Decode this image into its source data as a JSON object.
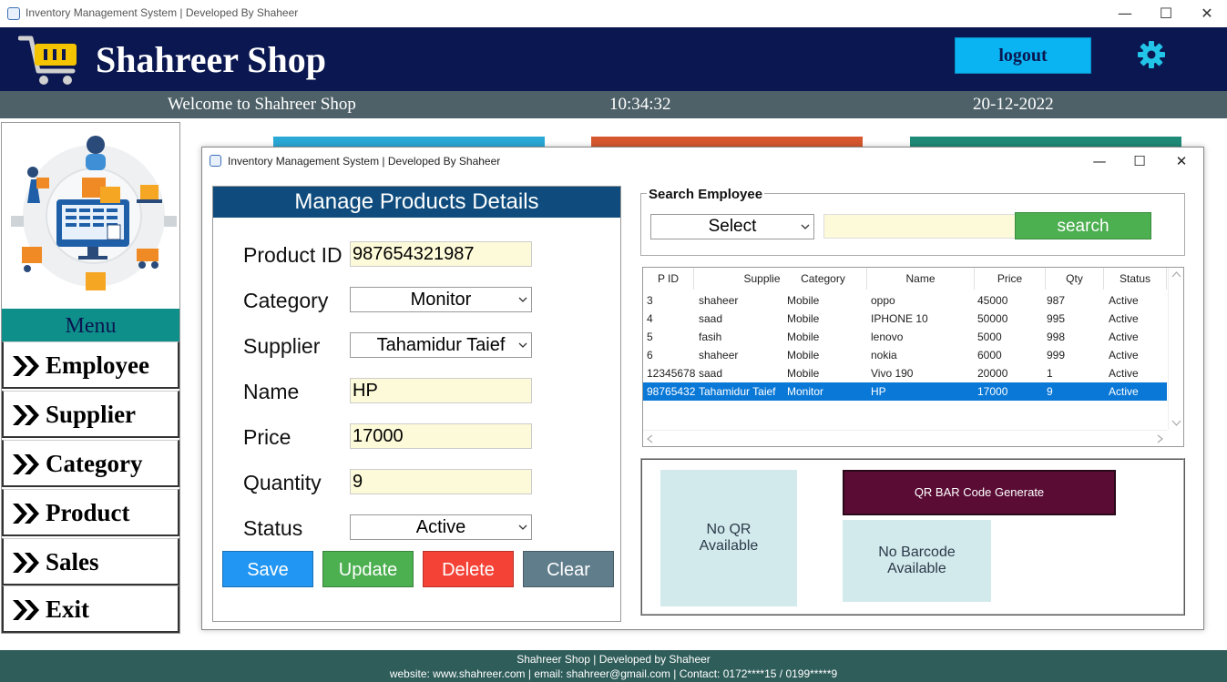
{
  "window": {
    "title": "Inventory Management System | Developed By Shaheer",
    "minimize": "—",
    "maximize": "☐",
    "close": "✕"
  },
  "header": {
    "shop_name": "Shahreer Shop",
    "logout_label": "logout",
    "welcome": "Welcome to Shahreer Shop",
    "clock": "10:34:32",
    "date": "20-12-2022"
  },
  "menu": {
    "heading": "Menu",
    "items": [
      "Employee",
      "Supplier",
      "Category",
      "Product",
      "Sales",
      "Exit"
    ]
  },
  "dialog": {
    "title": "Inventory Management System | Developed By Shaheer",
    "minimize": "—",
    "maximize": "☐",
    "close": "✕"
  },
  "form": {
    "heading": "Manage Products Details",
    "product_id": {
      "label": "Product ID",
      "value": "987654321987"
    },
    "category": {
      "label": "Category",
      "value": "Monitor"
    },
    "supplier": {
      "label": "Supplier",
      "value": "Tahamidur Taief"
    },
    "name": {
      "label": "Name",
      "value": "HP"
    },
    "price": {
      "label": "Price",
      "value": "17000"
    },
    "quantity": {
      "label": "Quantity",
      "value": "9"
    },
    "status": {
      "label": "Status",
      "value": "Active"
    },
    "buttons": {
      "save": "Save",
      "update": "Update",
      "delete": "Delete",
      "clear": "Clear"
    }
  },
  "search": {
    "legend": "Search Employee",
    "select_value": "Select",
    "input_value": "",
    "button": "search"
  },
  "table": {
    "columns": [
      "P ID",
      "Supplier",
      "Category",
      "Name",
      "Price",
      "Qty",
      "Status"
    ],
    "rows": [
      [
        "3",
        "shaheer",
        "Mobile",
        "oppo",
        "45000",
        "987",
        "Active"
      ],
      [
        "4",
        "saad",
        "Mobile",
        "IPHONE 10",
        "50000",
        "995",
        "Active"
      ],
      [
        "5",
        "fasih",
        "Mobile",
        "lenovo",
        "5000",
        "998",
        "Active"
      ],
      [
        "6",
        "shaheer",
        "Mobile",
        "nokia",
        "6000",
        "999",
        "Active"
      ],
      [
        "12345678",
        "saad",
        "Mobile",
        "Vivo 190",
        "20000",
        "1",
        "Active"
      ],
      [
        "98765432",
        "Tahamidur Taief",
        "Monitor",
        "HP",
        "17000",
        "9",
        "Active"
      ]
    ],
    "selected_row": 5
  },
  "codes": {
    "qr_line1": "No QR",
    "qr_line2": "Available",
    "generate_button": "QR BAR Code Generate",
    "barcode_line1": "No Barcode",
    "barcode_line2": "Available"
  },
  "footer": {
    "line1": "Shahreer Shop  |  Developed by Shaheer",
    "line2": "website: www.shahreer.com     |     email: shahreer@gmail.com     |     Contact: 0172****15 / 0199*****9"
  },
  "colors": {
    "header_bg": "#0a1750",
    "welcome_bg": "#4e6168",
    "menu_heading_bg": "#0f8f8a",
    "form_heading_bg": "#0f4c7d",
    "save": "#2196f3",
    "update": "#4caf50",
    "delete": "#f44336",
    "clear": "#607d8b",
    "selected_row": "#0a78d7",
    "generate_button": "#5a0c35",
    "footer_bg": "#2f5d5a"
  },
  "icons": [
    "cart-icon",
    "gear-icon",
    "chevron-down-icon",
    "double-chevron-icon",
    "app-icon"
  ]
}
